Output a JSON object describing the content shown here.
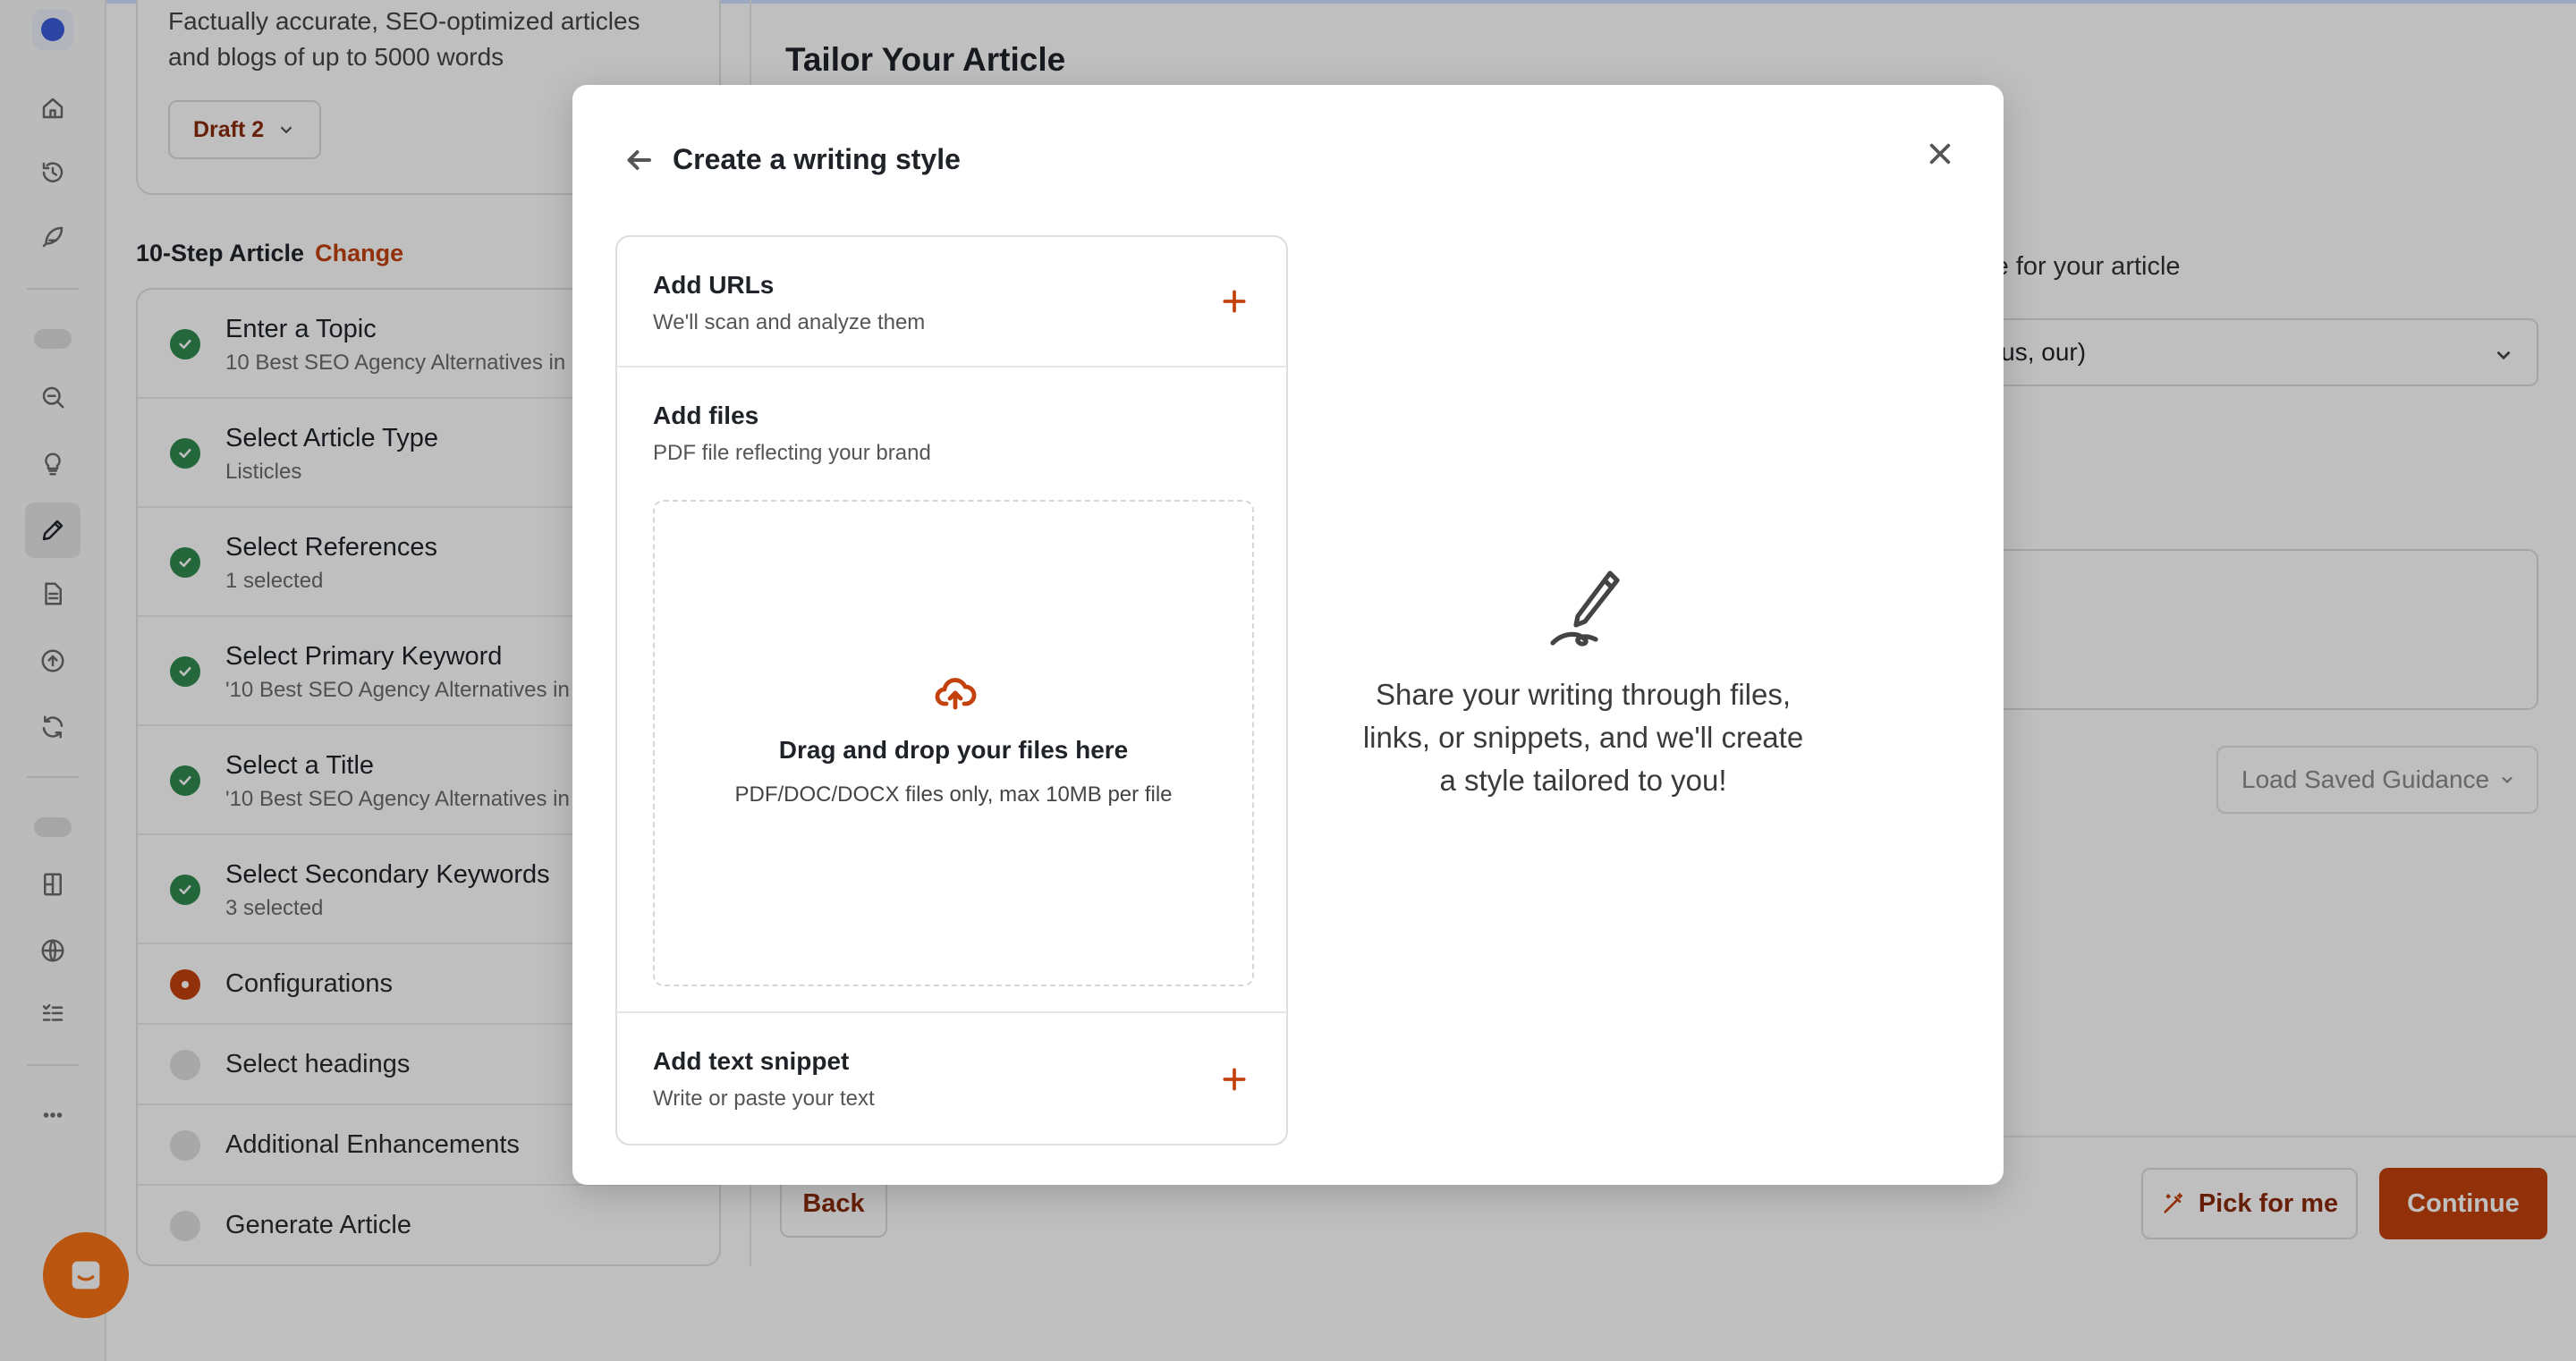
{
  "colors": {
    "accent": "#c2410c",
    "success": "#2f8a4e",
    "chat": "#f97316",
    "overlay": "rgba(0,0,0,0.25)"
  },
  "sidebar": {
    "icons": [
      "logo-icon",
      "home-icon",
      "history-icon",
      "feather-icon",
      "search-zoom-icon",
      "lightbulb-icon",
      "pencil-icon",
      "document-icon",
      "upload-icon",
      "refresh-icon",
      "book-icon",
      "globe-icon",
      "checklist-icon",
      "more-icon"
    ],
    "active": "pencil-icon"
  },
  "top_card": {
    "description": "Factually accurate, SEO-optimized articles and blogs of up to 5000 words",
    "draft_label": "Draft 2"
  },
  "steps_header": {
    "title": "10-Step Article",
    "change_link": "Change"
  },
  "steps": [
    {
      "title": "Enter a Topic",
      "sub": "10 Best SEO Agency Alternatives in",
      "status": "done"
    },
    {
      "title": "Select Article Type",
      "sub": "Listicles",
      "status": "done"
    },
    {
      "title": "Select References",
      "sub": "1 selected",
      "status": "done"
    },
    {
      "title": "Select Primary Keyword",
      "sub": "'10 Best SEO Agency Alternatives in",
      "status": "done"
    },
    {
      "title": "Select a Title",
      "sub": "'10 Best SEO Agency Alternatives in",
      "status": "done"
    },
    {
      "title": "Select Secondary Keywords",
      "sub": "3 selected",
      "status": "done"
    },
    {
      "title": "Configurations",
      "status": "current"
    },
    {
      "title": "Select headings",
      "status": "todo"
    },
    {
      "title": "Additional Enhancements",
      "status": "todo"
    },
    {
      "title": "Generate Article",
      "status": "todo"
    }
  ],
  "main": {
    "title": "Tailor Your Article",
    "perspective_label": "ective for your article",
    "perspective_value": "ve, us, our)",
    "load_saved": "Load Saved Guidance",
    "back": "Back",
    "pick_for_me": "Pick for me",
    "continue": "Continue"
  },
  "modal": {
    "title": "Create a writing style",
    "urls": {
      "title": "Add URLs",
      "sub": "We'll scan and analyze them"
    },
    "files": {
      "title": "Add files",
      "sub": "PDF file reflecting your brand",
      "drop_title": "Drag and drop your files here",
      "drop_sub": "PDF/DOC/DOCX files only, max 10MB per file"
    },
    "snippet": {
      "title": "Add text snippet",
      "sub": "Write or paste your text"
    },
    "help_text": "Share your writing through files, links, or snippets, and we'll create a style tailored to you!"
  }
}
